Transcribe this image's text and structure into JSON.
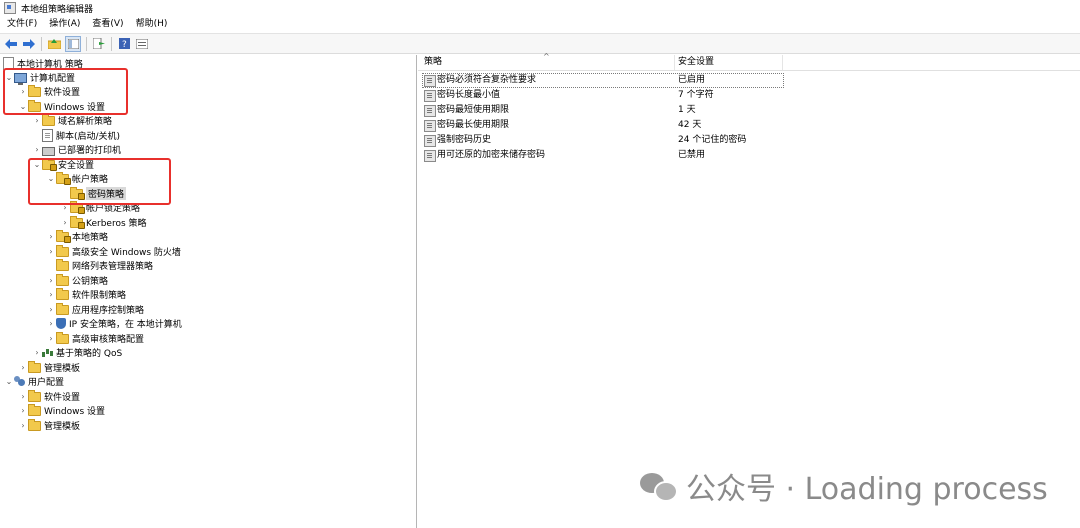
{
  "window": {
    "title": "本地组策略编辑器"
  },
  "menu": [
    "文件(F)",
    "操作(A)",
    "查看(V)",
    "帮助(H)"
  ],
  "tree": {
    "root": "本地计算机 策略",
    "computer_config": "计算机配置",
    "software_settings": "软件设置",
    "windows_settings": "Windows 设置",
    "name_resolution": "域名解析策略",
    "scripts": "脚本(启动/关机)",
    "printers": "已部署的打印机",
    "security_settings": "安全设置",
    "account_policies": "帐户策略",
    "password_policy": "密码策略",
    "lockout_policy": "帐户锁定策略",
    "kerberos_policy": "Kerberos 策略",
    "local_policies": "本地策略",
    "firewall": "高级安全 Windows 防火墙",
    "network_list": "网络列表管理器策略",
    "public_key": "公钥策略",
    "software_restriction": "软件限制策略",
    "app_control": "应用程序控制策略",
    "ipsec": "IP 安全策略，在 本地计算机",
    "audit": "高级审核策略配置",
    "qos": "基于策略的 QoS",
    "admin_templates": "管理模板",
    "user_config": "用户配置",
    "user_software": "软件设置",
    "user_windows": "Windows 设置",
    "user_admin_templates": "管理模板"
  },
  "list": {
    "col_policy": "策略",
    "col_setting": "安全设置",
    "rows": [
      {
        "name": "密码必须符合复杂性要求",
        "value": "已启用"
      },
      {
        "name": "密码长度最小值",
        "value": "7 个字符"
      },
      {
        "name": "密码最短使用期限",
        "value": "1 天"
      },
      {
        "name": "密码最长使用期限",
        "value": "42 天"
      },
      {
        "name": "强制密码历史",
        "value": "24 个记住的密码"
      },
      {
        "name": "用可还原的加密来储存密码",
        "value": "已禁用"
      }
    ]
  },
  "watermark": {
    "text": "公众号 · Loading process"
  },
  "colors": {
    "highlight_box": "#e8302c",
    "folder": "#f2c94c"
  }
}
